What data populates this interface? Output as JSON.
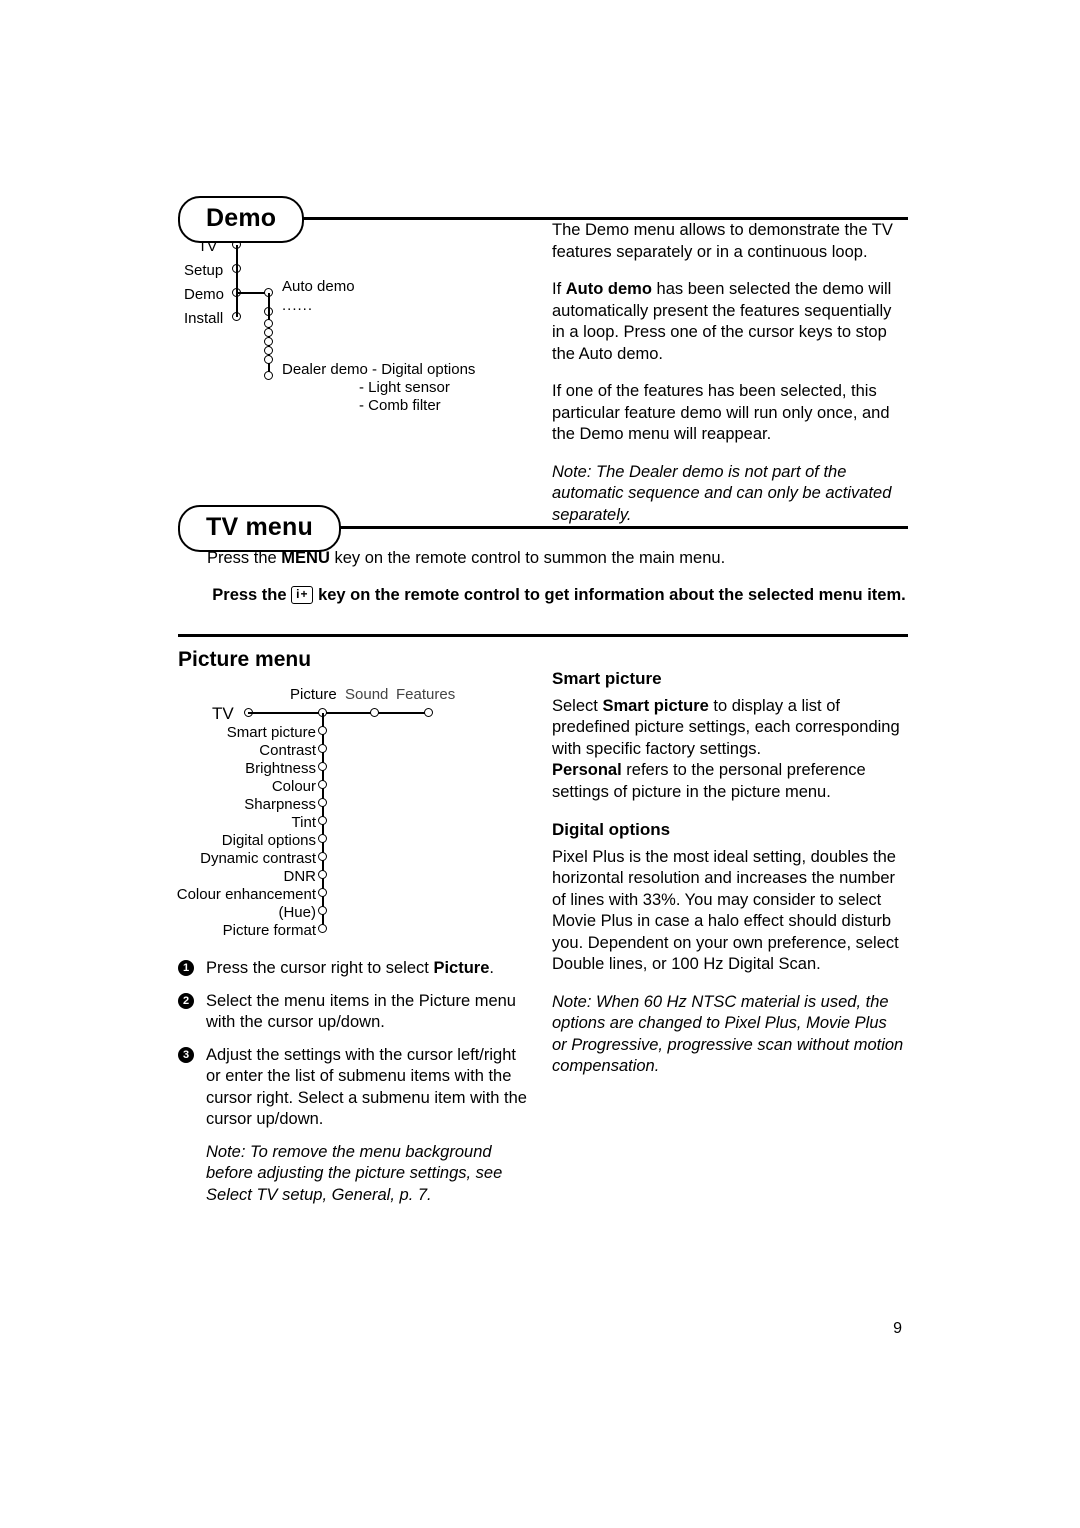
{
  "sections": {
    "demo": {
      "title": "Demo",
      "diagram": {
        "left_items": [
          "TV",
          "Setup",
          "Demo",
          "Install"
        ],
        "branch_items": [
          "Auto demo",
          "......"
        ],
        "dealer_label": "Dealer demo - Digital options",
        "dealer_sub": [
          "- Light sensor",
          "- Comb filter"
        ]
      },
      "paragraphs": {
        "p1": "The Demo menu allows to demonstrate the TV features separately or in a continuous loop.",
        "p2_a": "If ",
        "p2_b": "Auto demo",
        "p2_c": " has been selected the demo will automatically present the features sequentially in a loop. Press one of the cursor keys to stop the Auto demo.",
        "p3": "If one of the features has been selected, this particular feature demo will run only once, and the Demo menu will reappear.",
        "note": "Note: The Dealer demo is not part of the automatic sequence and can only be activated separately."
      }
    },
    "tv_menu": {
      "title": "TV menu",
      "line1_a": "Press the ",
      "line1_b": "MENU",
      "line1_c": " key on the remote control to summon the main menu.",
      "line2_a": "Press the ",
      "line2_key": "i+",
      "line2_b": " key on the remote control to get information about the selected menu item."
    },
    "picture_menu": {
      "title": "Picture menu",
      "diagram": {
        "tabs": [
          "Picture",
          "Sound",
          "Features"
        ],
        "root": "TV",
        "items": [
          "Smart picture",
          "Contrast",
          "Brightness",
          "Colour",
          "Sharpness",
          "Tint",
          "Digital options",
          "Dynamic contrast",
          "DNR",
          "Colour enhancement",
          "(Hue)",
          "Picture format"
        ]
      },
      "steps": [
        {
          "num": "1",
          "text_a": "Press the cursor right to select ",
          "text_b": "Picture",
          "text_c": "."
        },
        {
          "num": "2",
          "text_a": "Select the menu items in the Picture menu with the cursor up/down.",
          "text_b": "",
          "text_c": ""
        },
        {
          "num": "3",
          "text_a": "Adjust the settings with the cursor left/right or enter the list of submenu items with the cursor right. Select a submenu item with the cursor up/down.",
          "text_b": "",
          "text_c": ""
        }
      ],
      "step_note": "Note: To remove the menu background before adjusting the picture settings, see Select TV setup, General, p. 7.",
      "right": {
        "smart_picture_head": "Smart picture",
        "smart_p1_a": "Select ",
        "smart_p1_b": "Smart picture",
        "smart_p1_c": " to display a list of predefined picture settings, each corresponding with specific factory settings.",
        "smart_p2_a": "Personal",
        "smart_p2_b": " refers to the personal preference settings of picture in the picture menu.",
        "digital_options_head": "Digital options",
        "digital_p1": "Pixel Plus is the most ideal setting, doubles the horizontal resolution and increases the number of lines with 33%. You may consider to select Movie Plus in case a halo effect should disturb you. Dependent on your own preference, select Double lines, or 100 Hz Digital Scan.",
        "digital_note": "Note: When 60 Hz NTSC material is used, the options are changed to Pixel Plus, Movie Plus or Progressive, progressive scan without motion compensation."
      }
    }
  },
  "page_number": "9"
}
